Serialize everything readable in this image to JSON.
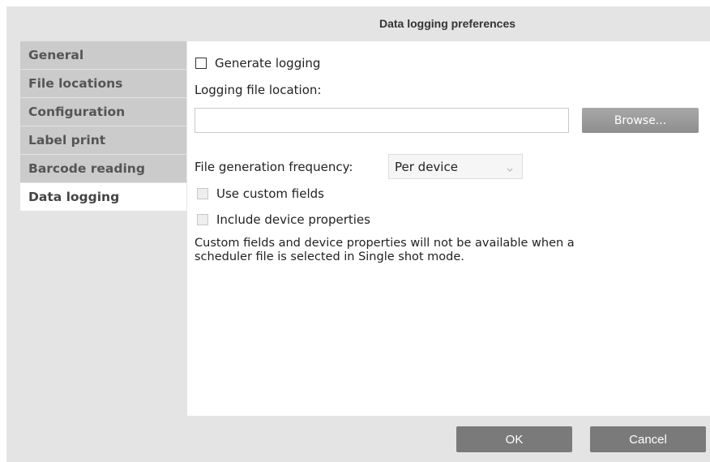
{
  "dialog": {
    "title": "Data logging preferences"
  },
  "sidebar": {
    "items": [
      {
        "label": "General"
      },
      {
        "label": "File locations"
      },
      {
        "label": "Configuration"
      },
      {
        "label": "Label print"
      },
      {
        "label": "Barcode reading"
      },
      {
        "label": "Data logging",
        "active": true
      }
    ]
  },
  "content": {
    "generate_logging": {
      "label": "Generate logging",
      "checked": false
    },
    "logging_location_label": "Logging file location:",
    "logging_location_value": "",
    "browse_label": "Browse...",
    "frequency_label": "File generation frequency:",
    "frequency_value": "Per device",
    "use_custom_fields": {
      "label": "Use custom fields",
      "checked": false,
      "disabled": true
    },
    "include_device_properties": {
      "label": "Include device properties",
      "checked": false,
      "disabled": true
    },
    "note": "Custom fields and device properties will not be available when a scheduler file is selected in Single shot mode."
  },
  "footer": {
    "ok_label": "OK",
    "cancel_label": "Cancel"
  },
  "icons": {
    "dropdown": "chevron-down-icon"
  },
  "colors": {
    "sidebar_bg": "#cbcbcb",
    "dialog_bg": "#e4e4e4",
    "button_bg": "#7a7a7a"
  }
}
